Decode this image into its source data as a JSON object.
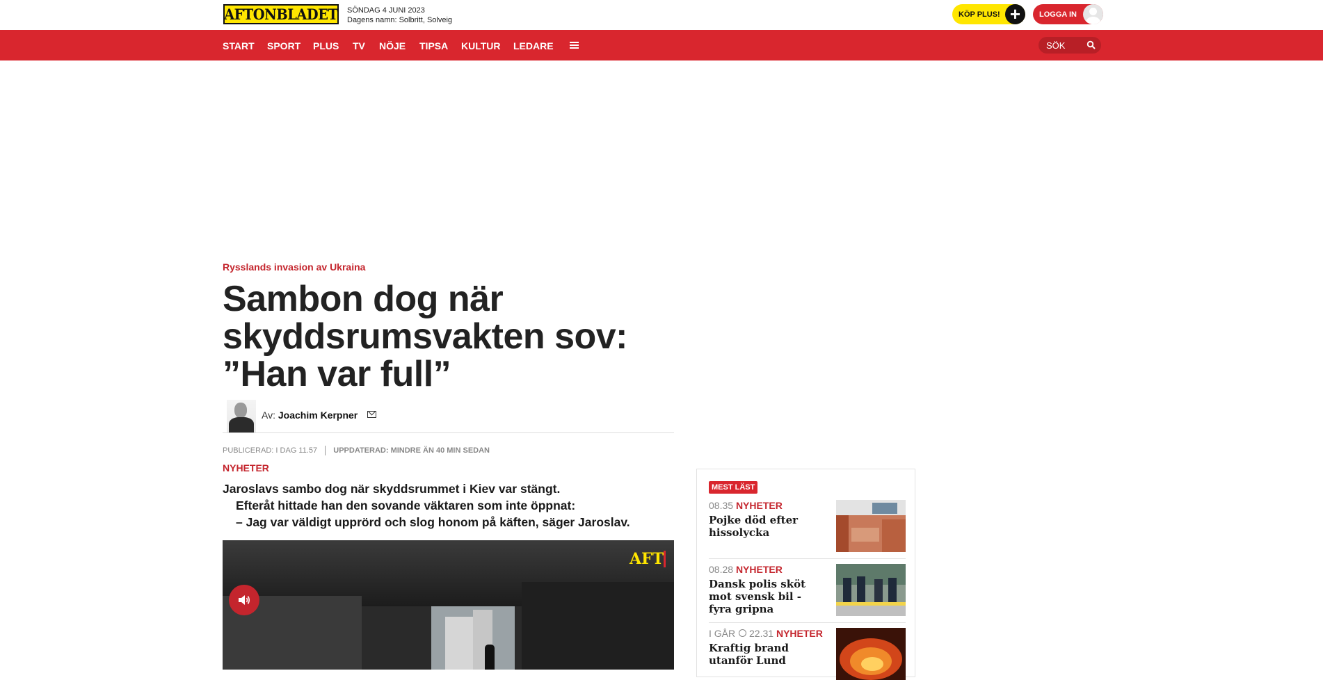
{
  "header": {
    "logo_text": "AFTONBLADET",
    "date": "SÖNDAG 4 JUNI 2023",
    "name_day": "Dagens namn: Solbritt, Solveig",
    "buy_plus_label": "KÖP PLUS!",
    "login_label": "LOGGA IN"
  },
  "nav": {
    "items": [
      "START",
      "SPORT",
      "PLUS",
      "TV",
      "NÖJE",
      "TIPSA",
      "KULTUR",
      "LEDARE"
    ],
    "search_label": "SÖK"
  },
  "article": {
    "kicker": "Rysslands invasion av Ukraina",
    "headline": "Sambon dog när skyddsrumsvakten sov: ”Han var full”",
    "byline_prefix": "Av:",
    "author": "Joachim Kerpner",
    "published_label": "PUBLICERAD:",
    "published_value": "I DAG 11.57",
    "updated_label": "UPPDATERAD:",
    "updated_value": "MINDRE ÄN 40 MIN SEDAN",
    "section": "NYHETER",
    "lead": [
      "Jaroslavs sambo dog när skyddsrummet i Kiev var stängt.",
      "Efteråt hittade han den sovande väktaren som inte öppnat:",
      "– Jag var väldigt upprörd och slog honom på käften, säger Jaroslav."
    ],
    "video_logo": "AFT"
  },
  "most_read": {
    "badge": "MEST LÄST",
    "items": [
      {
        "time": "08.35",
        "category": "NYHETER",
        "title": "Pojke död efter hissolycka"
      },
      {
        "time": "08.28",
        "category": "NYHETER",
        "title": "Dansk polis sköt mot svensk bil - fyra gripna"
      },
      {
        "day": "I GÅR",
        "time": "22.31",
        "category": "NYHETER",
        "title": "Kraftig brand utanför Lund"
      }
    ]
  },
  "colors": {
    "brand_red": "#d9262e",
    "brand_yellow": "#ffe600"
  }
}
